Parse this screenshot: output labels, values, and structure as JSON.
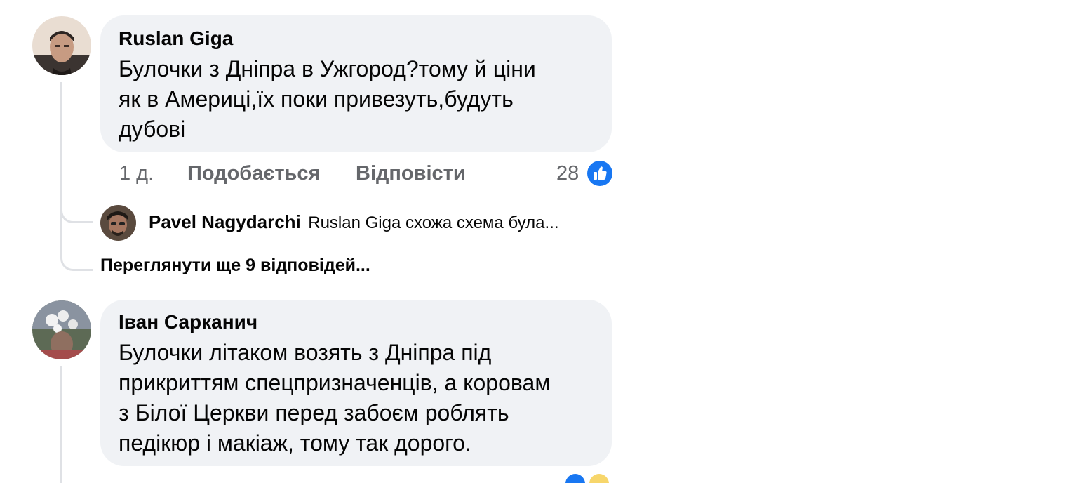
{
  "colors": {
    "bubble_bg": "#f0f2f5",
    "secondary_text": "#65676b",
    "like_blue": "#1877f2",
    "thread_line": "#dfe1e5"
  },
  "comments": [
    {
      "author": "Ruslan Giga",
      "text": "Булочки з Дніпра в Ужгород?тому й ціни\nяк в Америці,їх поки привезуть,будуть\nдубові",
      "time": "1 д.",
      "like_label": "Подобається",
      "reply_label": "Відповісти",
      "like_count": "28",
      "avatar_icon": "profile-photo",
      "like_icon": "thumbs-up-icon",
      "reply_preview": {
        "author": "Pavel Nagydarchi",
        "text": "Ruslan Giga схожа схема була..."
      },
      "more_replies": "Переглянути ще 9 відповідей..."
    },
    {
      "author": "Іван Сарканич",
      "text": "Булочки літаком возять з Дніпра під\nприкриттям спецпризначенців, а коровам\nз Білої Церкви перед забоєм роблять\nпедікюр і макіаж, тому так дорого.",
      "avatar_icon": "profile-photo"
    }
  ]
}
